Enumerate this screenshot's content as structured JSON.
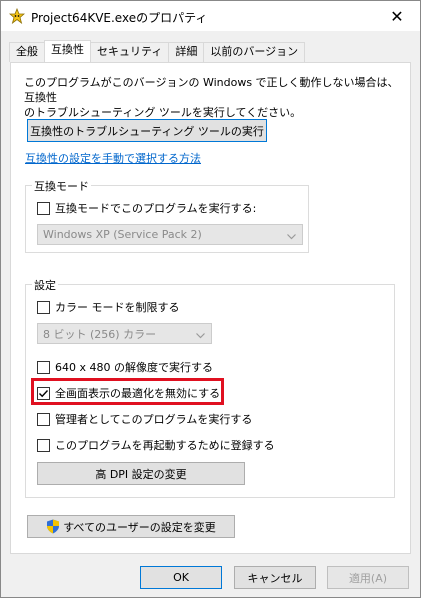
{
  "window": {
    "title": "Project64KVE.exeのプロパティ",
    "close_label": "✕"
  },
  "tabs": [
    {
      "label": "全般"
    },
    {
      "label": "互換性"
    },
    {
      "label": "セキュリティ"
    },
    {
      "label": "詳細"
    },
    {
      "label": "以前のバージョン"
    }
  ],
  "intro": {
    "line1": "このプログラムがこのバージョンの Windows で正しく動作しない場合は、互換性",
    "line2": "のトラブルシューティング ツールを実行してください。"
  },
  "troubleshoot_button": "互換性のトラブルシューティング ツールの実行",
  "manual_link": "互換性の設定を手動で選択する方法",
  "compat_mode": {
    "group_label": "互換モード",
    "checkbox_label": "互換モードでこのプログラムを実行する:",
    "checked": false,
    "select_value": "Windows XP (Service Pack 2)"
  },
  "settings": {
    "group_label": "設定",
    "color_mode_label": "カラー モードを制限する",
    "color_mode_checked": false,
    "color_select_value": "8 ビット (256) カラー",
    "resolution_label": "640 x 480 の解像度で実行する",
    "resolution_checked": false,
    "fullscreen_label": "全画面表示の最適化を無効にする",
    "fullscreen_checked": true,
    "admin_label": "管理者としてこのプログラムを実行する",
    "admin_checked": false,
    "restart_label": "このプログラムを再起動するために登録する",
    "restart_checked": false,
    "dpi_button": "高 DPI 設定の変更"
  },
  "all_users_button": "すべてのユーザーの設定を変更",
  "footer": {
    "ok": "OK",
    "cancel": "キャンセル",
    "apply": "適用(A)"
  },
  "colors": {
    "highlight": "#e01020",
    "link": "#0066cc",
    "focus": "#0078d7"
  }
}
